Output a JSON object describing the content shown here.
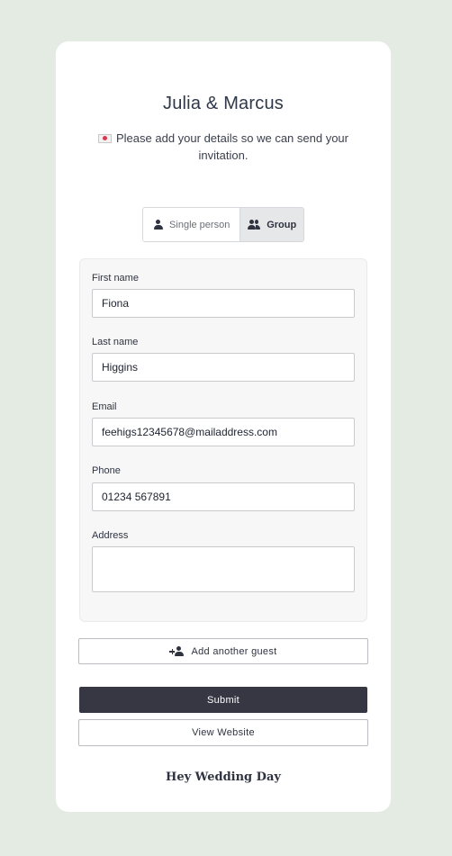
{
  "header": {
    "title": "Julia & Marcus",
    "subtitle": "Please add your details so we can send your invitation."
  },
  "toggle": {
    "single_label": "Single person",
    "group_label": "Group",
    "selected": "Group"
  },
  "form": {
    "first_name": {
      "label": "First name",
      "value": "Fiona"
    },
    "last_name": {
      "label": "Last name",
      "value": "Higgins"
    },
    "email": {
      "label": "Email",
      "value": "feehigs12345678@mailaddress.com"
    },
    "phone": {
      "label": "Phone",
      "value": "01234 567891"
    },
    "address": {
      "label": "Address",
      "value": ""
    }
  },
  "actions": {
    "add_guest_label": "Add another guest",
    "submit_label": "Submit",
    "view_website_label": "View Website"
  },
  "footer": {
    "brand": "Hey Wedding Day"
  },
  "colors": {
    "page_background": "#e3ebe3",
    "primary_button": "#373744",
    "selected_toggle": "#e6e7e9"
  },
  "icons": {
    "subtitle": "envelope-heart-icon",
    "single": "person-icon",
    "group": "group-icon",
    "add_guest": "add-person-icon"
  }
}
